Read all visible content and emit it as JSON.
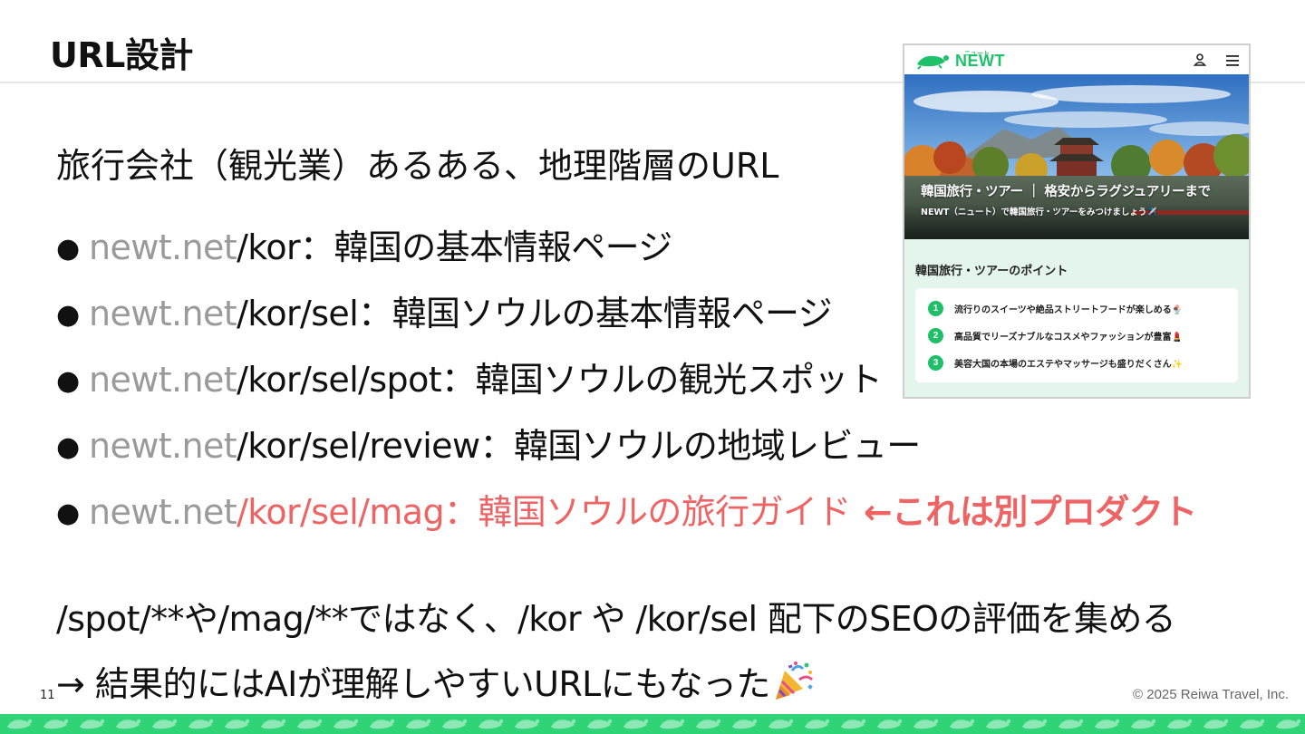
{
  "slide": {
    "title": "URL設計",
    "intro": "旅行会社（観光業）あるある、地理階層のURL",
    "bullets": [
      {
        "bullet": "●",
        "domain": "newt.net",
        "path": "/kor",
        "desc": "：韓国の基本情報ページ",
        "note": ""
      },
      {
        "bullet": "●",
        "domain": "newt.net",
        "path": "/kor/sel",
        "desc": "：韓国ソウルの基本情報ページ",
        "note": ""
      },
      {
        "bullet": "●",
        "domain": "newt.net",
        "path": "/kor/sel/spot",
        "desc": "：韓国ソウルの観光スポット",
        "note": ""
      },
      {
        "bullet": "●",
        "domain": "newt.net",
        "path": "/kor/sel/review",
        "desc": "：韓国ソウルの地域レビュー",
        "note": ""
      },
      {
        "bullet": "●",
        "domain": "newt.net",
        "path": "/kor/sel/mag",
        "desc": "：韓国ソウルの旅行ガイド",
        "note": "←これは別プロダクト"
      }
    ],
    "summary": "/spot/**や/mag/**ではなく、/kor や /kor/sel 配下のSEOの評価を集める",
    "conclusion": "→ 結果的にはAIが理解しやすいURLにもなった",
    "conclusion_icon": "party-popper-icon",
    "page_number": "11",
    "copyright": "© 2025 Reiwa Travel, Inc.",
    "accent_color": "#ee6464",
    "brand_color": "#2fd477"
  },
  "screenshot": {
    "logo_text": "NEWT",
    "logo_ruby": "ニュート",
    "icons": [
      "user-icon",
      "menu-icon"
    ],
    "hero_title": "韓国旅行・ツアー ｜ 格安からラグジュアリーまで",
    "hero_subtitle": "NEWT（ニュート）で韓国旅行・ツアーをみつけましょう✈️",
    "section_title": "韓国旅行・ツアーのポイント",
    "points": [
      {
        "num": "1",
        "text": "流行りのスイーツや絶品ストリートフードが楽しめる🍨"
      },
      {
        "num": "2",
        "text": "高品質でリーズナブルなコスメやファッションが豊富💄"
      },
      {
        "num": "3",
        "text": "美容大国の本場のエステやマッサージも盛りだくさん✨"
      }
    ]
  }
}
